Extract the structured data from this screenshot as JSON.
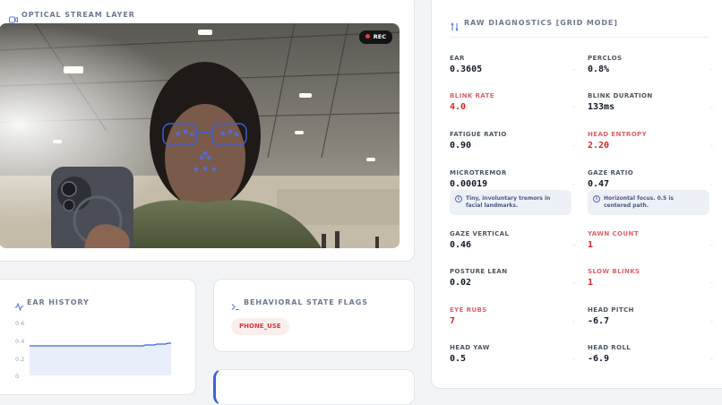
{
  "camera": {
    "title": "OPTICAL STREAM LAYER",
    "title_icon": "video-camera-icon",
    "rec_label": "REC"
  },
  "diagnostics": {
    "title": "RAW DIAGNOSTICS [GRID MODE]",
    "title_icon": "sliders-icon",
    "metrics": [
      {
        "label": "EAR",
        "value": "0.3605",
        "alert": false
      },
      {
        "label": "PERCLOS",
        "value": "0.8%",
        "alert": false
      },
      {
        "label": "BLINK RATE",
        "value": "4.0",
        "alert": true
      },
      {
        "label": "BLINK DURATION",
        "value": "133ms",
        "alert": false
      },
      {
        "label": "FATIGUE RATIO",
        "value": "0.90",
        "alert": false
      },
      {
        "label": "HEAD ENTROPY",
        "value": "2.20",
        "alert": true
      },
      {
        "label": "MICROTREMOR",
        "value": "0.00019",
        "alert": false
      },
      {
        "label": "GAZE RATIO",
        "value": "0.47",
        "alert": false
      },
      {
        "label": "GAZE VERTICAL",
        "value": "0.46",
        "alert": false
      },
      {
        "label": "YAWN COUNT",
        "value": "1",
        "alert": true
      },
      {
        "label": "POSTURE LEAN",
        "value": "0.02",
        "alert": false
      },
      {
        "label": "SLOW BLINKS",
        "value": "1",
        "alert": true
      },
      {
        "label": "EYE RUBS",
        "value": "7",
        "alert": true
      },
      {
        "label": "HEAD PITCH",
        "value": "-6.7",
        "alert": false
      },
      {
        "label": "HEAD YAW",
        "value": "0.5",
        "alert": false
      },
      {
        "label": "HEAD ROLL",
        "value": "-6.9",
        "alert": false
      }
    ],
    "info_microtremor": "Tiny, involuntary tremors in facial landmarks.",
    "info_gaze_ratio": "Horizontal focus. 0.5 is centered path.",
    "dash_glyph": "-"
  },
  "ear_history": {
    "title": "EAR HISTORY",
    "title_icon": "activity-icon",
    "y_ticks": [
      "0.6",
      "0.4",
      "0.2",
      "0"
    ]
  },
  "flags": {
    "title": "BEHAVIORAL STATE FLAGS",
    "title_icon": "terminal-icon",
    "items": [
      "PHONE_USE"
    ]
  },
  "chart_data": {
    "type": "area",
    "title": "EAR HISTORY",
    "ylim": [
      0,
      0.6
    ],
    "y_ticks": [
      0,
      0.2,
      0.4,
      0.6
    ],
    "grid": false,
    "series": [
      {
        "values": [
          0.33,
          0.33,
          0.33,
          0.33,
          0.33,
          0.33,
          0.33,
          0.33,
          0.33,
          0.33,
          0.33,
          0.33,
          0.33,
          0.33,
          0.33,
          0.33,
          0.33,
          0.33,
          0.33,
          0.33,
          0.33,
          0.33,
          0.33,
          0.33,
          0.33,
          0.33,
          0.33,
          0.33,
          0.33,
          0.33,
          0.33,
          0.33,
          0.33,
          0.33,
          0.33,
          0.33,
          0.33,
          0.33,
          0.33,
          0.33,
          0.33,
          0.34,
          0.34,
          0.34,
          0.34,
          0.35,
          0.35,
          0.35,
          0.35,
          0.36,
          0.36
        ]
      }
    ]
  },
  "colors": {
    "accent": "#3b63d8",
    "alert": "#dc2626",
    "chip_bg": "#fdeeee"
  }
}
